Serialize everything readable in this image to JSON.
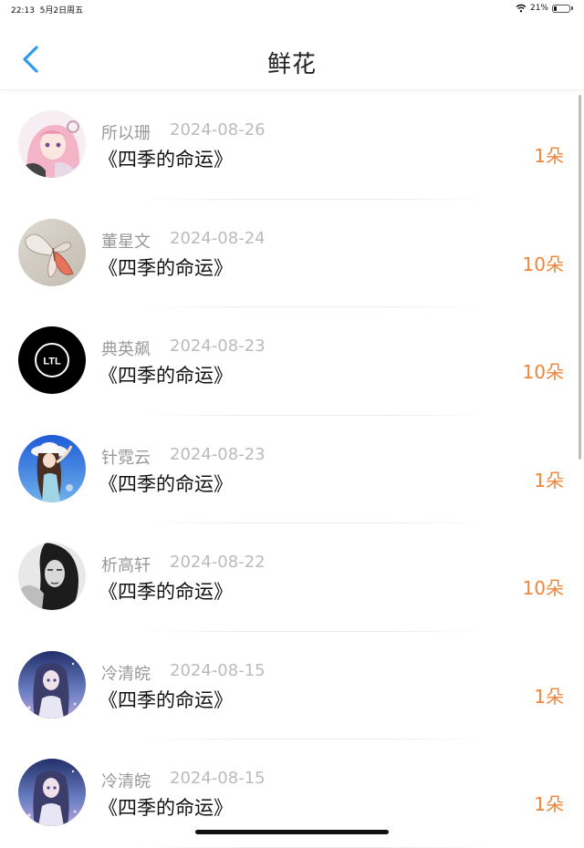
{
  "status": {
    "time": "22:13",
    "date": "5月2日周五",
    "battery": "21%",
    "battery_level": 0.21
  },
  "nav": {
    "title": "鲜花",
    "back_icon": "chevron-left-icon",
    "accent": "#2f9bf0"
  },
  "colors": {
    "count": "#f0853a",
    "name": "#999999",
    "date": "#bbbbbb"
  },
  "items": [
    {
      "name": "所以珊",
      "date": "2024-08-26",
      "book": "《四季的命运》",
      "count": "1朵",
      "avatar": "anime-girl-pink"
    },
    {
      "name": "董星文",
      "date": "2024-08-24",
      "book": "《四季的命运》",
      "count": "10朵",
      "avatar": "butterfly"
    },
    {
      "name": "典英飙",
      "date": "2024-08-23",
      "book": "《四季的命运》",
      "count": "10朵",
      "avatar": "ltl-logo",
      "logo_text": "LTL"
    },
    {
      "name": "针霓云",
      "date": "2024-08-23",
      "book": "《四季的命运》",
      "count": "1朵",
      "avatar": "anime-girl-sky"
    },
    {
      "name": "析高轩",
      "date": "2024-08-22",
      "book": "《四季的命运》",
      "count": "10朵",
      "avatar": "portrait-bw"
    },
    {
      "name": "冷清皖",
      "date": "2024-08-15",
      "book": "《四季的命运》",
      "count": "1朵",
      "avatar": "anime-girl-night"
    },
    {
      "name": "冷清皖",
      "date": "2024-08-15",
      "book": "《四季的命运》",
      "count": "1朵",
      "avatar": "anime-girl-night"
    }
  ]
}
